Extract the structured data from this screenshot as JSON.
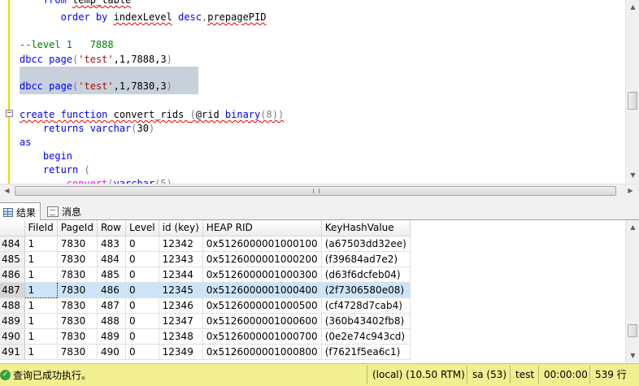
{
  "editor": {
    "lines": [
      {
        "segments": [
          {
            "t": "    ",
            "c": ""
          },
          {
            "t": "from",
            "c": "kw"
          },
          {
            "t": " ",
            "c": ""
          },
          {
            "t": "temp_table",
            "c": "squig"
          }
        ]
      },
      {
        "segments": [
          {
            "t": "       ",
            "c": ""
          },
          {
            "t": "order by",
            "c": "kw"
          },
          {
            "t": " ",
            "c": ""
          },
          {
            "t": "indexLevel",
            "c": "squig"
          },
          {
            "t": " ",
            "c": ""
          },
          {
            "t": "desc",
            "c": "kw"
          },
          {
            "t": ",",
            "c": "grey"
          },
          {
            "t": "prepagePID",
            "c": "squig"
          }
        ]
      },
      {
        "segments": []
      },
      {
        "segments": [
          {
            "t": "--level 1   7888",
            "c": "cmt"
          }
        ]
      },
      {
        "segments": [
          {
            "t": "dbcc",
            "c": "kw"
          },
          {
            "t": " ",
            "c": ""
          },
          {
            "t": "page",
            "c": "kw"
          },
          {
            "t": "(",
            "c": "grey"
          },
          {
            "t": "'test'",
            "c": "str"
          },
          {
            "t": ",1,7888,3",
            "c": ""
          },
          {
            "t": ")",
            "c": "grey"
          }
        ]
      },
      {
        "segments": []
      },
      {
        "segments": [
          {
            "t": "dbcc",
            "c": "kw"
          },
          {
            "t": " ",
            "c": ""
          },
          {
            "t": "page",
            "c": "kw"
          },
          {
            "t": "(",
            "c": "grey"
          },
          {
            "t": "'test'",
            "c": "str"
          },
          {
            "t": ",1,7830,3",
            "c": ""
          },
          {
            "t": ")",
            "c": "grey"
          }
        ]
      },
      {
        "segments": []
      },
      {
        "segments": [
          {
            "t": "create",
            "c": "kw squig"
          },
          {
            "t": " ",
            "c": "squig"
          },
          {
            "t": "function",
            "c": "kw squig"
          },
          {
            "t": " convert_rids ",
            "c": "squig"
          },
          {
            "t": "(",
            "c": "grey squig"
          },
          {
            "t": "@rid ",
            "c": "squig"
          },
          {
            "t": "binary",
            "c": "kw squig"
          },
          {
            "t": "(8))",
            "c": "grey squig"
          }
        ]
      },
      {
        "segments": [
          {
            "t": "    ",
            "c": ""
          },
          {
            "t": "returns",
            "c": "kw"
          },
          {
            "t": " ",
            "c": ""
          },
          {
            "t": "varchar",
            "c": "kw"
          },
          {
            "t": "(",
            "c": "grey"
          },
          {
            "t": "30",
            "c": ""
          },
          {
            "t": ")",
            "c": "grey"
          }
        ]
      },
      {
        "segments": [
          {
            "t": "as",
            "c": "kw"
          }
        ]
      },
      {
        "segments": [
          {
            "t": "    ",
            "c": ""
          },
          {
            "t": "begin",
            "c": "kw"
          }
        ]
      },
      {
        "segments": [
          {
            "t": "    ",
            "c": ""
          },
          {
            "t": "return",
            "c": "kw"
          },
          {
            "t": " (",
            "c": "grey"
          }
        ]
      },
      {
        "segments": [
          {
            "t": "        ",
            "c": ""
          },
          {
            "t": "convert",
            "c": "fn squig"
          },
          {
            "t": "(",
            "c": "grey"
          },
          {
            "t": "varchar",
            "c": "kw squig"
          },
          {
            "t": "(5)",
            "c": "grey"
          }
        ]
      }
    ],
    "selected_line": 6
  },
  "tabs": [
    {
      "label": "结果",
      "icon": "grid-icon",
      "active": true
    },
    {
      "label": "消息",
      "icon": "message-icon",
      "active": false
    }
  ],
  "results": {
    "columns": [
      "",
      "FileId",
      "PageId",
      "Row",
      "Level",
      "id (key)",
      "HEAP RID",
      "KeyHashValue"
    ],
    "rows": [
      [
        "484",
        "1",
        "7830",
        "483",
        "0",
        "12342",
        "0x5126000001000100",
        "(a67503dd32ee)"
      ],
      [
        "485",
        "1",
        "7830",
        "484",
        "0",
        "12343",
        "0x5126000001000200",
        "(f39684ad7e2)"
      ],
      [
        "486",
        "1",
        "7830",
        "485",
        "0",
        "12344",
        "0x5126000001000300",
        "(d63f6dcfeb04)"
      ],
      [
        "487",
        "1",
        "7830",
        "486",
        "0",
        "12345",
        "0x5126000001000400",
        "(2f7306580e08)"
      ],
      [
        "488",
        "1",
        "7830",
        "487",
        "0",
        "12346",
        "0x5126000001000500",
        "(cf4728d7cab4)"
      ],
      [
        "489",
        "1",
        "7830",
        "488",
        "0",
        "12347",
        "0x5126000001000600",
        "(360b43402fb8)"
      ],
      [
        "490",
        "1",
        "7830",
        "489",
        "0",
        "12348",
        "0x5126000001000700",
        "(0e2e74c943cd)"
      ],
      [
        "491",
        "1",
        "7830",
        "490",
        "0",
        "12349",
        "0x5126000001000800",
        "(f7621f5ea6c1)"
      ]
    ],
    "selected_row": 3
  },
  "status": {
    "message": "查询已成功执行。",
    "server": "(local) (10.50 RTM)",
    "user": "sa (53)",
    "database": "test",
    "elapsed": "00:00:00",
    "rows": "539 行"
  }
}
